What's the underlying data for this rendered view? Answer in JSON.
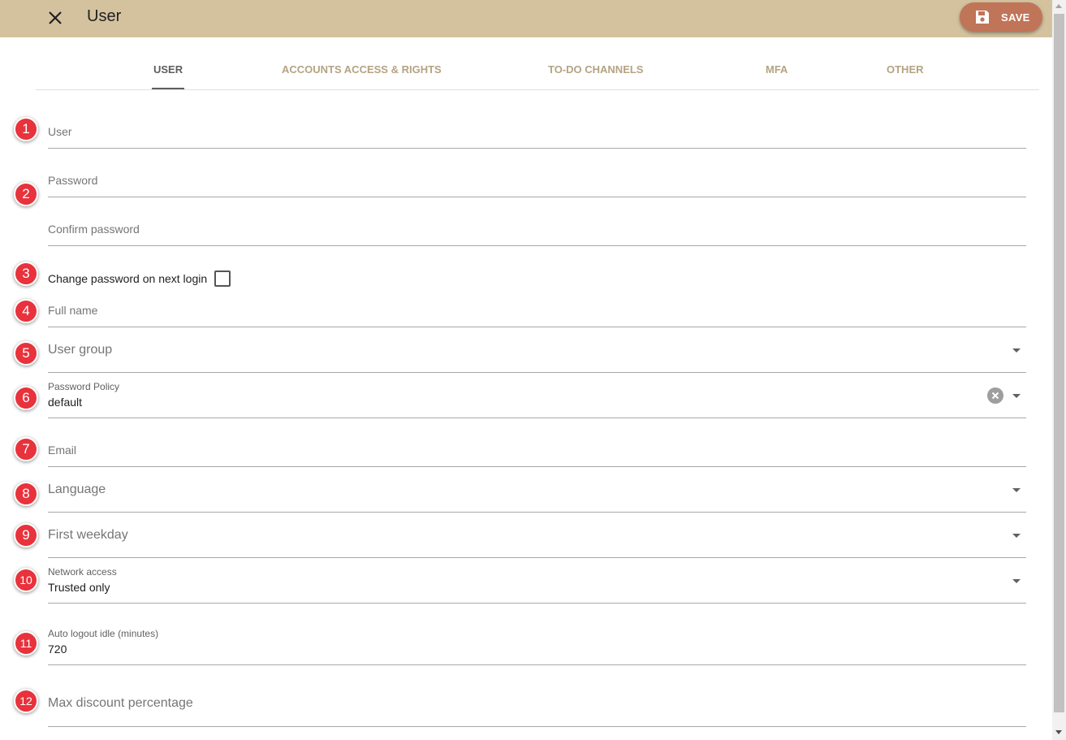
{
  "header": {
    "title": "User",
    "close_icon": "close-icon",
    "save_label": "SAVE",
    "save_icon": "floppy-disk-icon",
    "bar_color": "#d4c29f",
    "save_color": "#c07458"
  },
  "tabs": [
    {
      "label": "USER",
      "active": true
    },
    {
      "label": "ACCOUNTS ACCESS & RIGHTS",
      "active": false
    },
    {
      "label": "TO-DO CHANNELS",
      "active": false
    },
    {
      "label": "MFA",
      "active": false
    },
    {
      "label": "OTHER",
      "active": false
    }
  ],
  "badges": [
    "1",
    "2",
    "3",
    "4",
    "5",
    "6",
    "7",
    "8",
    "9",
    "10",
    "11",
    "12"
  ],
  "form": {
    "user": {
      "placeholder": "User"
    },
    "password": {
      "placeholder": "Password"
    },
    "confirm_password": {
      "placeholder": "Confirm password"
    },
    "change_password": {
      "label": "Change password on next login",
      "checked": false
    },
    "full_name": {
      "placeholder": "Full name"
    },
    "user_group": {
      "placeholder": "User group"
    },
    "password_policy": {
      "label": "Password Policy",
      "value": "default"
    },
    "email": {
      "placeholder": "Email"
    },
    "language": {
      "placeholder": "Language"
    },
    "first_weekday": {
      "placeholder": "First weekday"
    },
    "network_access": {
      "label": "Network access",
      "value": "Trusted only"
    },
    "auto_logout": {
      "label": "Auto logout idle (minutes)",
      "value": "720"
    },
    "max_discount": {
      "placeholder": "Max discount percentage"
    }
  },
  "colors": {
    "badge": "#e8323c",
    "tab_inactive": "#b4a383",
    "tab_active": "#5e5e5e"
  }
}
